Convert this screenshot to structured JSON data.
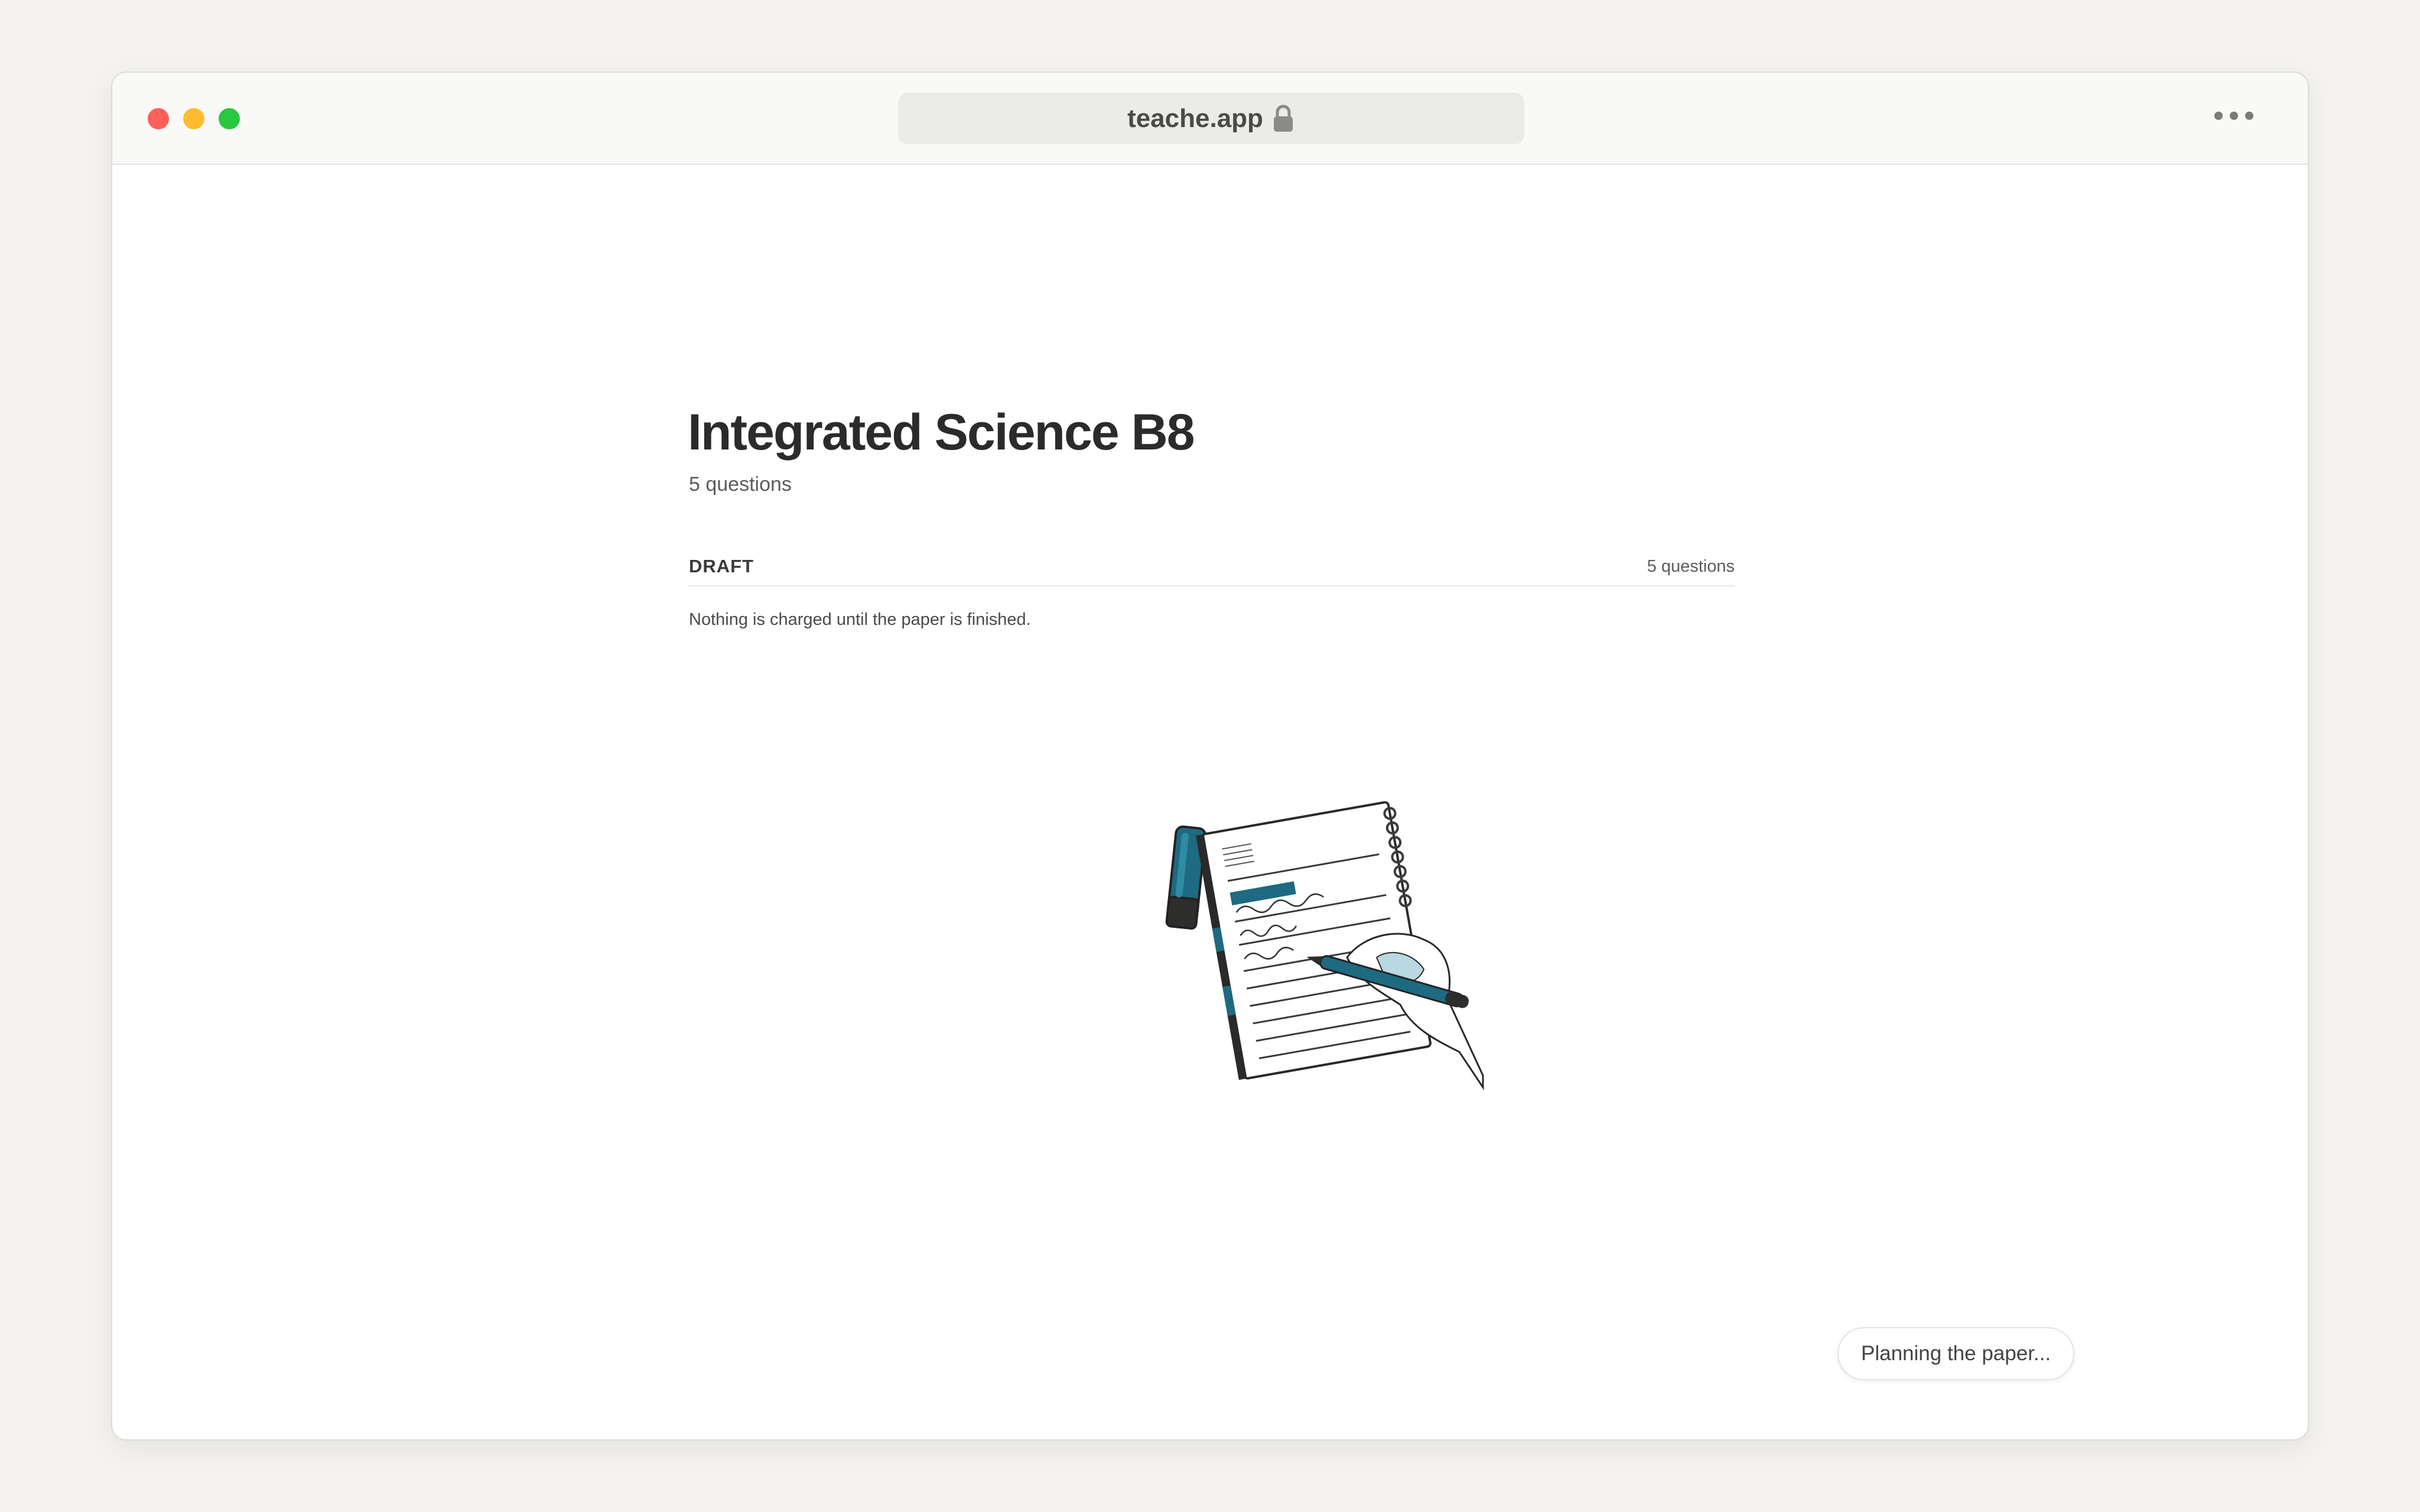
{
  "browser": {
    "url": "teache.app",
    "lock_icon": "lock-icon",
    "menu_icon": "ellipsis-icon"
  },
  "page": {
    "title": "Integrated Science B8",
    "subtitle": "5 questions",
    "draft": {
      "label": "DRAFT",
      "count": "5 questions"
    },
    "note": "Nothing is charged until the paper is finished.",
    "illustration": "hand-writing-notebook-illustration",
    "status": "Planning the paper..."
  },
  "colors": {
    "accent": "#1e6a80",
    "close": "#fe5f57",
    "minimize": "#febc2e",
    "maximize": "#28c840"
  }
}
